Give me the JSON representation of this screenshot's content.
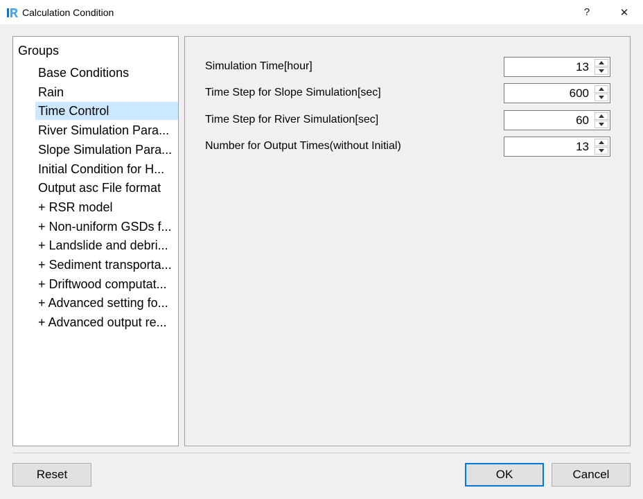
{
  "window": {
    "title": "Calculation Condition",
    "help_label": "?",
    "close_label": "✕"
  },
  "tree": {
    "header": "Groups",
    "selected_index": 2,
    "items": [
      {
        "label": "Base Conditions"
      },
      {
        "label": "Rain"
      },
      {
        "label": "Time Control"
      },
      {
        "label": "River Simulation Para..."
      },
      {
        "label": "Slope Simulation Para..."
      },
      {
        "label": "Initial Condition for H..."
      },
      {
        "label": "Output asc File format"
      },
      {
        "label": "+ RSR model"
      },
      {
        "label": "+ Non-uniform GSDs f..."
      },
      {
        "label": "+ Landslide and debri..."
      },
      {
        "label": "+ Sediment transporta..."
      },
      {
        "label": "+ Driftwood computat..."
      },
      {
        "label": "+ Advanced setting fo..."
      },
      {
        "label": "+ Advanced output re..."
      }
    ]
  },
  "fields": [
    {
      "label": "Simulation Time[hour]",
      "value": "13"
    },
    {
      "label": "Time Step for Slope Simulation[sec]",
      "value": "600"
    },
    {
      "label": "Time Step for River Simulation[sec]",
      "value": "60"
    },
    {
      "label": "Number for Output Times(without Initial)",
      "value": "13"
    }
  ],
  "buttons": {
    "reset": "Reset",
    "ok": "OK",
    "cancel": "Cancel"
  },
  "colors": {
    "selection": "#cce8ff",
    "default_button_border": "#0078d7",
    "app_icon": "#1a6fc0"
  }
}
